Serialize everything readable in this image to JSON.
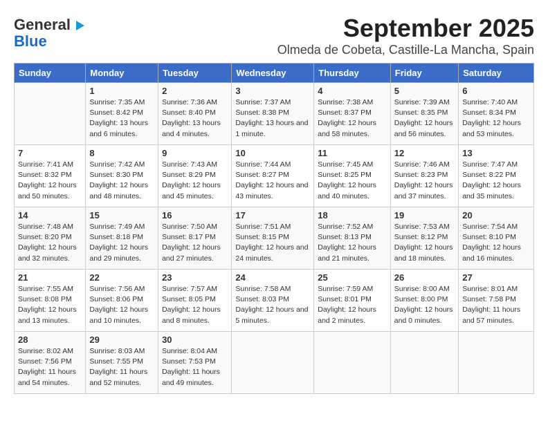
{
  "logo": {
    "line1": "General",
    "line2": "Blue"
  },
  "title": "September 2025",
  "subtitle": "Olmeda de Cobeta, Castille-La Mancha, Spain",
  "days_of_week": [
    "Sunday",
    "Monday",
    "Tuesday",
    "Wednesday",
    "Thursday",
    "Friday",
    "Saturday"
  ],
  "weeks": [
    [
      {
        "day": "",
        "sunrise": "",
        "sunset": "",
        "daylight": ""
      },
      {
        "day": "1",
        "sunrise": "Sunrise: 7:35 AM",
        "sunset": "Sunset: 8:42 PM",
        "daylight": "Daylight: 13 hours and 6 minutes."
      },
      {
        "day": "2",
        "sunrise": "Sunrise: 7:36 AM",
        "sunset": "Sunset: 8:40 PM",
        "daylight": "Daylight: 13 hours and 4 minutes."
      },
      {
        "day": "3",
        "sunrise": "Sunrise: 7:37 AM",
        "sunset": "Sunset: 8:38 PM",
        "daylight": "Daylight: 13 hours and 1 minute."
      },
      {
        "day": "4",
        "sunrise": "Sunrise: 7:38 AM",
        "sunset": "Sunset: 8:37 PM",
        "daylight": "Daylight: 12 hours and 58 minutes."
      },
      {
        "day": "5",
        "sunrise": "Sunrise: 7:39 AM",
        "sunset": "Sunset: 8:35 PM",
        "daylight": "Daylight: 12 hours and 56 minutes."
      },
      {
        "day": "6",
        "sunrise": "Sunrise: 7:40 AM",
        "sunset": "Sunset: 8:34 PM",
        "daylight": "Daylight: 12 hours and 53 minutes."
      }
    ],
    [
      {
        "day": "7",
        "sunrise": "Sunrise: 7:41 AM",
        "sunset": "Sunset: 8:32 PM",
        "daylight": "Daylight: 12 hours and 50 minutes."
      },
      {
        "day": "8",
        "sunrise": "Sunrise: 7:42 AM",
        "sunset": "Sunset: 8:30 PM",
        "daylight": "Daylight: 12 hours and 48 minutes."
      },
      {
        "day": "9",
        "sunrise": "Sunrise: 7:43 AM",
        "sunset": "Sunset: 8:29 PM",
        "daylight": "Daylight: 12 hours and 45 minutes."
      },
      {
        "day": "10",
        "sunrise": "Sunrise: 7:44 AM",
        "sunset": "Sunset: 8:27 PM",
        "daylight": "Daylight: 12 hours and 43 minutes."
      },
      {
        "day": "11",
        "sunrise": "Sunrise: 7:45 AM",
        "sunset": "Sunset: 8:25 PM",
        "daylight": "Daylight: 12 hours and 40 minutes."
      },
      {
        "day": "12",
        "sunrise": "Sunrise: 7:46 AM",
        "sunset": "Sunset: 8:23 PM",
        "daylight": "Daylight: 12 hours and 37 minutes."
      },
      {
        "day": "13",
        "sunrise": "Sunrise: 7:47 AM",
        "sunset": "Sunset: 8:22 PM",
        "daylight": "Daylight: 12 hours and 35 minutes."
      }
    ],
    [
      {
        "day": "14",
        "sunrise": "Sunrise: 7:48 AM",
        "sunset": "Sunset: 8:20 PM",
        "daylight": "Daylight: 12 hours and 32 minutes."
      },
      {
        "day": "15",
        "sunrise": "Sunrise: 7:49 AM",
        "sunset": "Sunset: 8:18 PM",
        "daylight": "Daylight: 12 hours and 29 minutes."
      },
      {
        "day": "16",
        "sunrise": "Sunrise: 7:50 AM",
        "sunset": "Sunset: 8:17 PM",
        "daylight": "Daylight: 12 hours and 27 minutes."
      },
      {
        "day": "17",
        "sunrise": "Sunrise: 7:51 AM",
        "sunset": "Sunset: 8:15 PM",
        "daylight": "Daylight: 12 hours and 24 minutes."
      },
      {
        "day": "18",
        "sunrise": "Sunrise: 7:52 AM",
        "sunset": "Sunset: 8:13 PM",
        "daylight": "Daylight: 12 hours and 21 minutes."
      },
      {
        "day": "19",
        "sunrise": "Sunrise: 7:53 AM",
        "sunset": "Sunset: 8:12 PM",
        "daylight": "Daylight: 12 hours and 18 minutes."
      },
      {
        "day": "20",
        "sunrise": "Sunrise: 7:54 AM",
        "sunset": "Sunset: 8:10 PM",
        "daylight": "Daylight: 12 hours and 16 minutes."
      }
    ],
    [
      {
        "day": "21",
        "sunrise": "Sunrise: 7:55 AM",
        "sunset": "Sunset: 8:08 PM",
        "daylight": "Daylight: 12 hours and 13 minutes."
      },
      {
        "day": "22",
        "sunrise": "Sunrise: 7:56 AM",
        "sunset": "Sunset: 8:06 PM",
        "daylight": "Daylight: 12 hours and 10 minutes."
      },
      {
        "day": "23",
        "sunrise": "Sunrise: 7:57 AM",
        "sunset": "Sunset: 8:05 PM",
        "daylight": "Daylight: 12 hours and 8 minutes."
      },
      {
        "day": "24",
        "sunrise": "Sunrise: 7:58 AM",
        "sunset": "Sunset: 8:03 PM",
        "daylight": "Daylight: 12 hours and 5 minutes."
      },
      {
        "day": "25",
        "sunrise": "Sunrise: 7:59 AM",
        "sunset": "Sunset: 8:01 PM",
        "daylight": "Daylight: 12 hours and 2 minutes."
      },
      {
        "day": "26",
        "sunrise": "Sunrise: 8:00 AM",
        "sunset": "Sunset: 8:00 PM",
        "daylight": "Daylight: 12 hours and 0 minutes."
      },
      {
        "day": "27",
        "sunrise": "Sunrise: 8:01 AM",
        "sunset": "Sunset: 7:58 PM",
        "daylight": "Daylight: 11 hours and 57 minutes."
      }
    ],
    [
      {
        "day": "28",
        "sunrise": "Sunrise: 8:02 AM",
        "sunset": "Sunset: 7:56 PM",
        "daylight": "Daylight: 11 hours and 54 minutes."
      },
      {
        "day": "29",
        "sunrise": "Sunrise: 8:03 AM",
        "sunset": "Sunset: 7:55 PM",
        "daylight": "Daylight: 11 hours and 52 minutes."
      },
      {
        "day": "30",
        "sunrise": "Sunrise: 8:04 AM",
        "sunset": "Sunset: 7:53 PM",
        "daylight": "Daylight: 11 hours and 49 minutes."
      },
      {
        "day": "",
        "sunrise": "",
        "sunset": "",
        "daylight": ""
      },
      {
        "day": "",
        "sunrise": "",
        "sunset": "",
        "daylight": ""
      },
      {
        "day": "",
        "sunrise": "",
        "sunset": "",
        "daylight": ""
      },
      {
        "day": "",
        "sunrise": "",
        "sunset": "",
        "daylight": ""
      }
    ]
  ]
}
